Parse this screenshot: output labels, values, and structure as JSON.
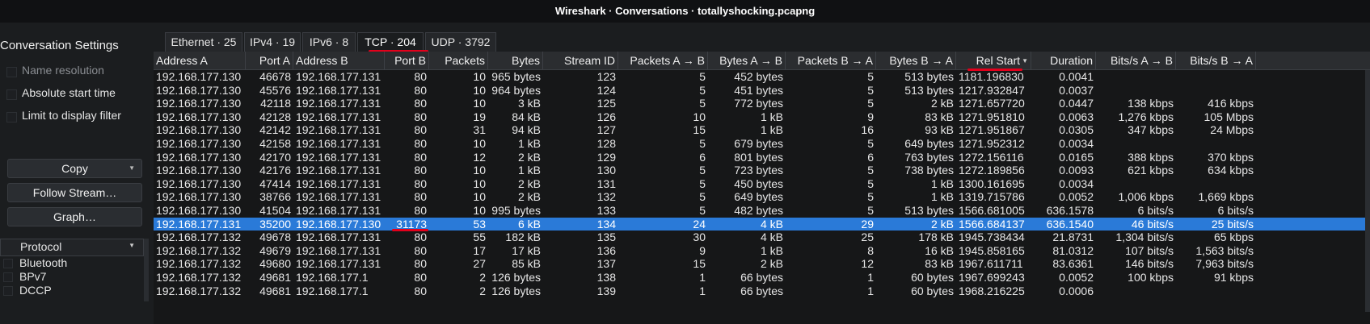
{
  "window_title": "Wireshark · Conversations · totallyshocking.pcapng",
  "settings": {
    "title": "Conversation Settings",
    "name_resolution": "Name resolution",
    "absolute_start_time": "Absolute start time",
    "limit_to_display_filter": "Limit to display filter",
    "copy_label": "Copy",
    "follow_stream_label": "Follow Stream…",
    "graph_label": "Graph…"
  },
  "protocols": {
    "header": "Protocol",
    "items": [
      "Bluetooth",
      "BPv7",
      "DCCP"
    ]
  },
  "tabs": [
    {
      "label": "Ethernet · 25"
    },
    {
      "label": "IPv4 · 19"
    },
    {
      "label": "IPv6 · 8"
    },
    {
      "label": "TCP · 204"
    },
    {
      "label": "UDP · 3792"
    }
  ],
  "columns": [
    "Address A",
    "Port A",
    "Address B",
    "Port B",
    "Packets",
    "Bytes",
    "Stream ID",
    "Packets A → B",
    "Bytes A → B",
    "Packets B → A",
    "Bytes B → A",
    "Rel Start",
    "Duration",
    "Bits/s A → B",
    "Bits/s B → A"
  ],
  "rows": [
    [
      "192.168.177.130",
      "46678",
      "192.168.177.131",
      "80",
      "10",
      "965 bytes",
      "123",
      "5",
      "452 bytes",
      "5",
      "513 bytes",
      "1181.196830",
      "0.0041",
      "",
      ""
    ],
    [
      "192.168.177.130",
      "45576",
      "192.168.177.131",
      "80",
      "10",
      "964 bytes",
      "124",
      "5",
      "451 bytes",
      "5",
      "513 bytes",
      "1217.932847",
      "0.0037",
      "",
      ""
    ],
    [
      "192.168.177.130",
      "42118",
      "192.168.177.131",
      "80",
      "10",
      "3 kB",
      "125",
      "5",
      "772 bytes",
      "5",
      "2 kB",
      "1271.657720",
      "0.0447",
      "138 kbps",
      "416 kbps"
    ],
    [
      "192.168.177.130",
      "42128",
      "192.168.177.131",
      "80",
      "19",
      "84 kB",
      "126",
      "10",
      "1 kB",
      "9",
      "83 kB",
      "1271.951810",
      "0.0063",
      "1,276 kbps",
      "105 Mbps"
    ],
    [
      "192.168.177.130",
      "42142",
      "192.168.177.131",
      "80",
      "31",
      "94 kB",
      "127",
      "15",
      "1 kB",
      "16",
      "93 kB",
      "1271.951867",
      "0.0305",
      "347 kbps",
      "24 Mbps"
    ],
    [
      "192.168.177.130",
      "42158",
      "192.168.177.131",
      "80",
      "10",
      "1 kB",
      "128",
      "5",
      "679 bytes",
      "5",
      "649 bytes",
      "1271.952312",
      "0.0034",
      "",
      ""
    ],
    [
      "192.168.177.130",
      "42170",
      "192.168.177.131",
      "80",
      "12",
      "2 kB",
      "129",
      "6",
      "801 bytes",
      "6",
      "763 bytes",
      "1272.156116",
      "0.0165",
      "388 kbps",
      "370 kbps"
    ],
    [
      "192.168.177.130",
      "42176",
      "192.168.177.131",
      "80",
      "10",
      "1 kB",
      "130",
      "5",
      "723 bytes",
      "5",
      "738 bytes",
      "1272.189856",
      "0.0093",
      "621 kbps",
      "634 kbps"
    ],
    [
      "192.168.177.130",
      "47414",
      "192.168.177.131",
      "80",
      "10",
      "2 kB",
      "131",
      "5",
      "450 bytes",
      "5",
      "1 kB",
      "1300.161695",
      "0.0034",
      "",
      ""
    ],
    [
      "192.168.177.130",
      "38766",
      "192.168.177.131",
      "80",
      "10",
      "2 kB",
      "132",
      "5",
      "649 bytes",
      "5",
      "1 kB",
      "1319.715786",
      "0.0052",
      "1,006 kbps",
      "1,669 kbps"
    ],
    [
      "192.168.177.130",
      "41504",
      "192.168.177.131",
      "80",
      "10",
      "995 bytes",
      "133",
      "5",
      "482 bytes",
      "5",
      "513 bytes",
      "1566.681005",
      "636.1578",
      "6 bits/s",
      "6 bits/s"
    ],
    [
      "192.168.177.131",
      "35200",
      "192.168.177.130",
      "31173",
      "53",
      "6 kB",
      "134",
      "24",
      "4 kB",
      "29",
      "2 kB",
      "1566.684137",
      "636.1540",
      "46 bits/s",
      "25 bits/s"
    ],
    [
      "192.168.177.132",
      "49678",
      "192.168.177.131",
      "80",
      "55",
      "182 kB",
      "135",
      "30",
      "4 kB",
      "25",
      "178 kB",
      "1945.738434",
      "21.8731",
      "1,304 bits/s",
      "65 kbps"
    ],
    [
      "192.168.177.132",
      "49679",
      "192.168.177.131",
      "80",
      "17",
      "17 kB",
      "136",
      "9",
      "1 kB",
      "8",
      "16 kB",
      "1945.858165",
      "81.0312",
      "107 bits/s",
      "1,563 bits/s"
    ],
    [
      "192.168.177.132",
      "49680",
      "192.168.177.131",
      "80",
      "27",
      "85 kB",
      "137",
      "15",
      "2 kB",
      "12",
      "83 kB",
      "1967.611711",
      "83.6361",
      "146 bits/s",
      "7,963 bits/s"
    ],
    [
      "192.168.177.132",
      "49681",
      "192.168.177.1",
      "80",
      "2",
      "126 bytes",
      "138",
      "1",
      "66 bytes",
      "1",
      "60 bytes",
      "1967.699243",
      "0.0052",
      "100 kbps",
      "91 kbps"
    ],
    [
      "192.168.177.132",
      "49681",
      "192.168.177.1",
      "80",
      "2",
      "126 bytes",
      "139",
      "1",
      "66 bytes",
      "1",
      "60 bytes",
      "1968.216225",
      "0.0006",
      "",
      ""
    ]
  ],
  "selected_row_index": 11,
  "colors": {
    "selection": "#2a7ad8",
    "highlight_underline": "#e3001b"
  }
}
